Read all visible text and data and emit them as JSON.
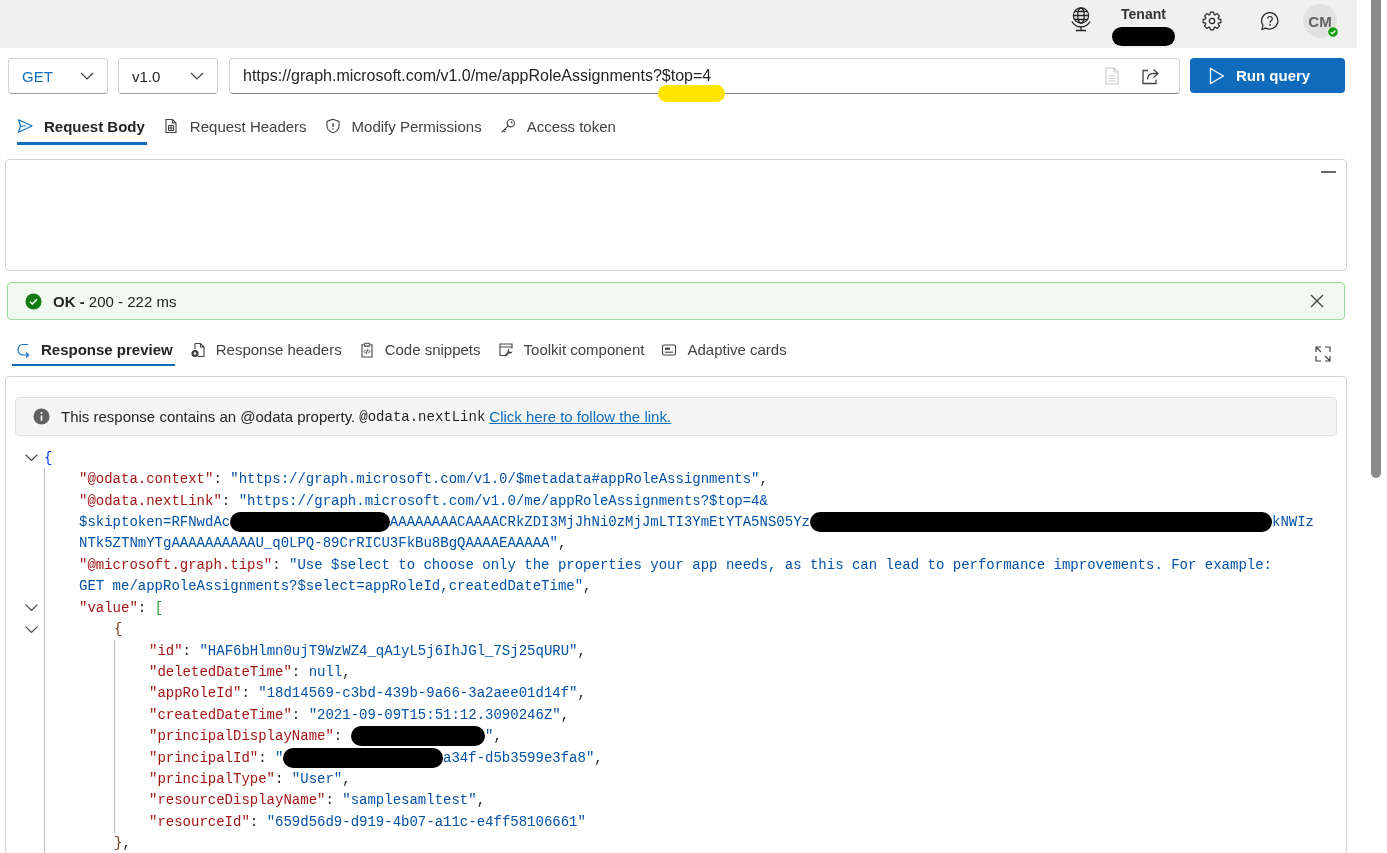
{
  "header": {
    "tenant": {
      "label": "Tenant",
      "name_redacted": true
    },
    "avatar": {
      "initials": "CM",
      "available": true
    }
  },
  "query_bar": {
    "method": {
      "value": "GET"
    },
    "version": {
      "value": "v1.0"
    },
    "url": {
      "parts": [
        {
          "text": "https://graph.microsoft.com/v1.0/me/appRoleAssignments?",
          "highlighted": false
        },
        {
          "text": "$top=4",
          "highlighted": true
        }
      ],
      "actions": [
        {
          "kind": "document",
          "disabled": true
        },
        {
          "kind": "share",
          "disabled": false
        }
      ]
    },
    "run_button": {
      "label": "Run query"
    }
  },
  "request_tabs": [
    {
      "label": "Request Body",
      "selected": true
    },
    {
      "label": "Request Headers",
      "selected": false
    },
    {
      "label": "Modify Permissions",
      "selected": false
    },
    {
      "label": "Access token",
      "selected": false
    }
  ],
  "status": {
    "kind": "success",
    "text": "**OK -** 200 - 222 ms"
  },
  "response_tabs": [
    {
      "label": "Response preview",
      "selected": true
    },
    {
      "label": "Response headers",
      "selected": false
    },
    {
      "label": "Code snippets",
      "selected": false
    },
    {
      "label": "Toolkit component",
      "selected": false
    },
    {
      "label": "Adaptive cards",
      "selected": false
    }
  ],
  "response": {
    "notice": {
      "text": "This response contains an @odata property.",
      "code": "@odata.nextLink",
      "link": "Click here to follow the link."
    },
    "json": {
      "tokens": [
        {
          "kind": "bracket",
          "text": "{"
        }
      ],
      "expanded": true,
      "children": [
        {
          "tokens": [
            {
              "kind": "key",
              "text": "\"@odata.context\""
            },
            {
              "kind": "punct",
              "text": ": "
            },
            {
              "kind": "string",
              "text": "\"https://graph.microsoft.com/v1.0/$metadata#appRoleAssignments\""
            },
            {
              "kind": "punct",
              "text": ","
            }
          ]
        },
        {
          "tokens": [
            {
              "kind": "key",
              "text": "\"@odata.nextLink\""
            },
            {
              "kind": "punct",
              "text": ": "
            },
            {
              "kind": "string",
              "text": "\"https://graph.microsoft.com/v1.0/me/appRoleAssignments?$top=4&"
            }
          ]
        },
        {
          "tokens": [
            {
              "kind": "string",
              "text": "$skiptoken=RFNwdAc"
            },
            {
              "kind": "redacted_medium"
            },
            {
              "kind": "string",
              "text": "AAAAAAAACAAAACRkZDI3MjJhNi0zMjJmLTI3YmEtYTA5NS05Yz"
            },
            {
              "kind": "redacted_long"
            },
            {
              "kind": "string",
              "text": "kNWIz"
            }
          ]
        },
        {
          "tokens": [
            {
              "kind": "string",
              "text": "NTk5ZTNmYTgAAAAAAAAAAU_q0LPQ-89CrRICU3FkBu8BgQAAAAEAAAAA\""
            },
            {
              "kind": "punct",
              "text": ","
            }
          ]
        },
        {
          "tokens": [
            {
              "kind": "key",
              "text": "\"@microsoft.graph.tips\""
            },
            {
              "kind": "punct",
              "text": ": "
            },
            {
              "kind": "string",
              "text": "\"Use $select to choose only the properties your app needs, as this can lead to performance improvements. For example:"
            }
          ]
        },
        {
          "tokens": [
            {
              "kind": "string",
              "text": "GET me/appRoleAssignments?$select=appRoleId,createdDateTime\""
            },
            {
              "kind": "punct",
              "text": ","
            }
          ]
        },
        {
          "tokens": [
            {
              "kind": "key",
              "text": "\"value\""
            },
            {
              "kind": "punct",
              "text": ": "
            },
            {
              "kind": "bracket",
              "text": "["
            }
          ],
          "expanded": true,
          "children": [
            {
              "tokens": [
                {
                  "kind": "bracket",
                  "text": "{"
                }
              ],
              "expanded": true,
              "children": [
                {
                  "tokens": [
                    {
                      "kind": "key",
                      "text": "\"id\""
                    },
                    {
                      "kind": "punct",
                      "text": ": "
                    },
                    {
                      "kind": "string",
                      "text": "\"HAF6bHlmn0ujT9WzWZ4_qA1yL5j6IhJGl_7Sj25qURU\""
                    },
                    {
                      "kind": "punct",
                      "text": ","
                    }
                  ]
                },
                {
                  "tokens": [
                    {
                      "kind": "key",
                      "text": "\"deletedDateTime\""
                    },
                    {
                      "kind": "punct",
                      "text": ": "
                    },
                    {
                      "kind": "literal",
                      "text": "null"
                    },
                    {
                      "kind": "punct",
                      "text": ","
                    }
                  ]
                },
                {
                  "tokens": [
                    {
                      "kind": "key",
                      "text": "\"appRoleId\""
                    },
                    {
                      "kind": "punct",
                      "text": ": "
                    },
                    {
                      "kind": "string",
                      "text": "\"18d14569-c3bd-439b-9a66-3a2aee01d14f\""
                    },
                    {
                      "kind": "punct",
                      "text": ","
                    }
                  ]
                },
                {
                  "tokens": [
                    {
                      "kind": "key",
                      "text": "\"createdDateTime\""
                    },
                    {
                      "kind": "punct",
                      "text": ": "
                    },
                    {
                      "kind": "string",
                      "text": "\"2021-09-09T15:51:12.3090246Z\""
                    },
                    {
                      "kind": "punct",
                      "text": ","
                    }
                  ]
                },
                {
                  "tokens": [
                    {
                      "kind": "key",
                      "text": "\"principalDisplayName\""
                    },
                    {
                      "kind": "punct",
                      "text": ": "
                    },
                    {
                      "kind": "redacted_short"
                    },
                    {
                      "kind": "string",
                      "text": "\""
                    },
                    {
                      "kind": "punct",
                      "text": ","
                    }
                  ]
                },
                {
                  "tokens": [
                    {
                      "kind": "key",
                      "text": "\"principalId\""
                    },
                    {
                      "kind": "punct",
                      "text": ": "
                    },
                    {
                      "kind": "string",
                      "text": "\""
                    },
                    {
                      "kind": "redacted_medium"
                    },
                    {
                      "kind": "string",
                      "text": "a34f-d5b3599e3fa8\""
                    },
                    {
                      "kind": "punct",
                      "text": ","
                    }
                  ]
                },
                {
                  "tokens": [
                    {
                      "kind": "key",
                      "text": "\"principalType\""
                    },
                    {
                      "kind": "punct",
                      "text": ": "
                    },
                    {
                      "kind": "string",
                      "text": "\"User\""
                    },
                    {
                      "kind": "punct",
                      "text": ","
                    }
                  ]
                },
                {
                  "tokens": [
                    {
                      "kind": "key",
                      "text": "\"resourceDisplayName\""
                    },
                    {
                      "kind": "punct",
                      "text": ": "
                    },
                    {
                      "kind": "string",
                      "text": "\"samplesamltest\""
                    },
                    {
                      "kind": "punct",
                      "text": ","
                    }
                  ]
                },
                {
                  "tokens": [
                    {
                      "kind": "key",
                      "text": "\"resourceId\""
                    },
                    {
                      "kind": "punct",
                      "text": ": "
                    },
                    {
                      "kind": "string",
                      "text": "\"659d56d9-d919-4b07-a11c-e4ff58106661\""
                    }
                  ]
                }
              ],
              "closing": [
                {
                  "kind": "bracket",
                  "text": "}"
                },
                {
                  "kind": "punct",
                  "text": ","
                }
              ]
            }
          ]
        }
      ]
    }
  }
}
